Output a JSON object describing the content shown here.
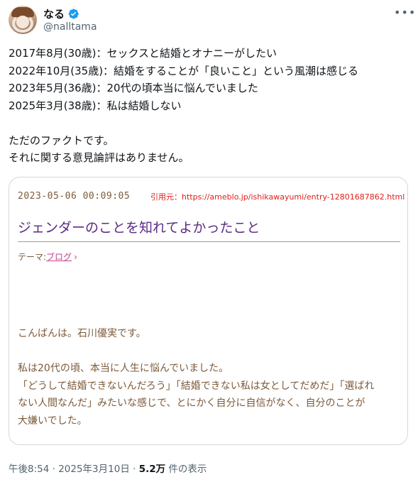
{
  "author": {
    "display_name": "なる",
    "handle": "@nalltama",
    "verified_icon": "verified-badge-icon",
    "more_icon": "more-icon"
  },
  "tweet": {
    "lines": [
      "2017年8月(30歳)：セックスと結婚とオナニーがしたい",
      "2022年10月(35歳)：結婚をすることが「良いこと」という風潮は感じる",
      "2023年5月(36歳)：20代の頃本当に悩んでいました",
      "2025年3月(38歳)：私は結婚しない",
      "",
      "ただのファクトです。",
      "それに関する意見論評はありません。"
    ]
  },
  "quote": {
    "date": "2023-05-06 00:09:05",
    "source": "引用元：https://ameblo.jp/ishikawayumi/entry-12801687862.html",
    "title": "ジェンダーのことを知れてよかったこと",
    "theme_label": "テーマ:",
    "theme_link": "ブログ",
    "body": [
      "こんばんは。石川優実です。",
      "",
      "私は20代の頃、本当に人生に悩んでいました。",
      "「どうして結婚できないんだろう」「結婚できない私は女としてだめだ」「選ばれ",
      "ない人間なんだ」みたいな感じで、とにかく自分に自信がなく、自分のことが",
      "大嫌いでした。"
    ],
    "colors": {
      "date": "#7d5a3a",
      "source": "#e0201a",
      "title": "#5b2b86",
      "link": "#c0428a"
    }
  },
  "meta": {
    "time": "午後8:54",
    "sep1": " · ",
    "date": "2025年3月10日",
    "sep2": " · ",
    "views": "5.2万",
    "views_suffix": " 件の表示"
  },
  "colors": {
    "verified": "#1d9bf0",
    "secondary_text": "#536471",
    "border": "#cfd9de"
  }
}
